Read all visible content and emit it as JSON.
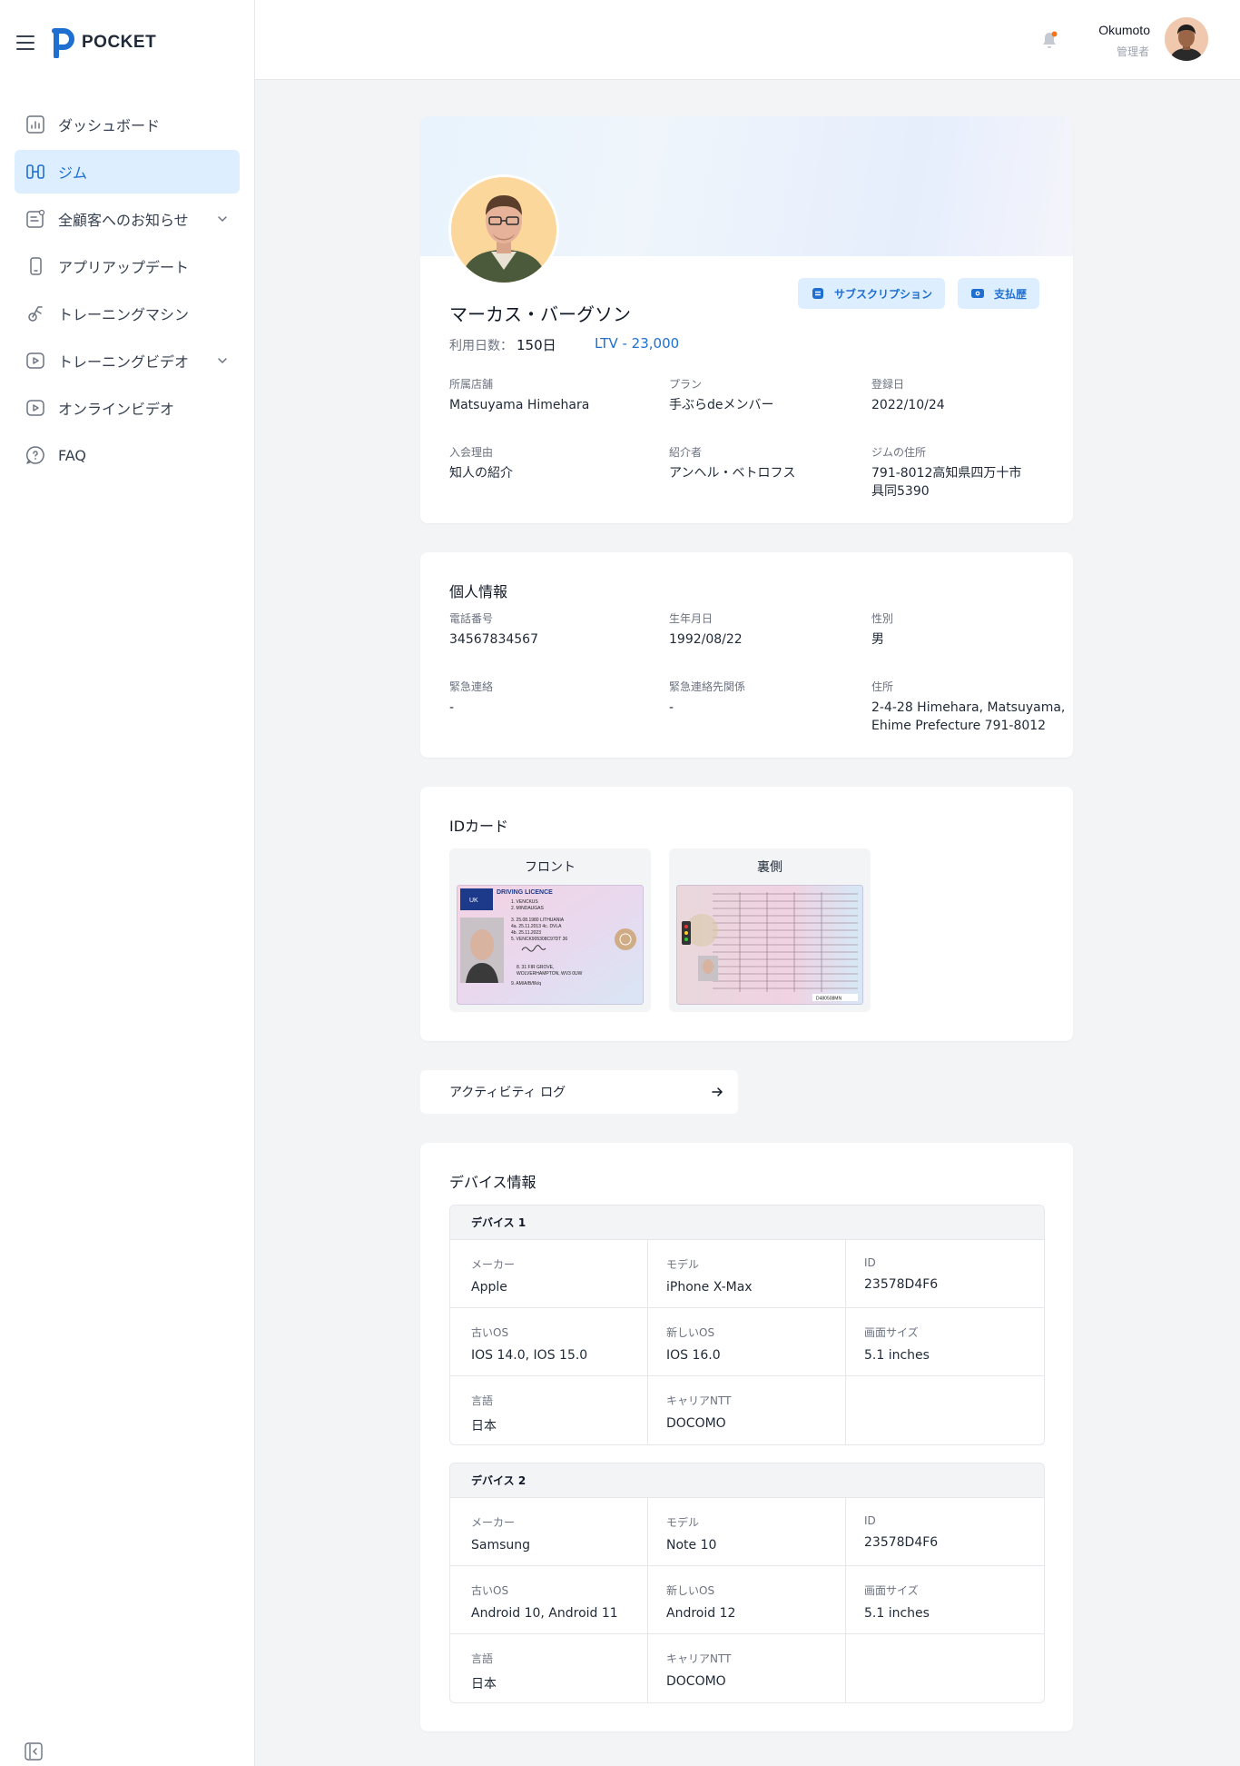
{
  "sidebar": {
    "brand": "POCKET",
    "items": [
      {
        "label": "ダッシュボード",
        "icon": "chart-icon"
      },
      {
        "label": "ジム",
        "icon": "gym-icon",
        "active": true
      },
      {
        "label": "全顧客へのお知らせ",
        "icon": "announcement-icon",
        "has_children": true
      },
      {
        "label": "アプリアップデート",
        "icon": "phone-icon"
      },
      {
        "label": "トレーニングマシン",
        "icon": "machine-icon"
      },
      {
        "label": "トレーニングビデオ",
        "icon": "video-icon",
        "has_children": true
      },
      {
        "label": "オンラインビデオ",
        "icon": "video-icon"
      },
      {
        "label": "FAQ",
        "icon": "faq-icon"
      }
    ]
  },
  "header": {
    "user_name": "Okumoto",
    "user_role": "管理者"
  },
  "profile": {
    "name": "マーカス・バーグソン",
    "days_label": "利用日数：",
    "days_value": "150日",
    "ltv": "LTV - 23,000",
    "subscription_button": "サブスクリプション",
    "payment_button": "支払歴",
    "fields": {
      "store_label": "所属店舗",
      "store_value": "Matsuyama Himehara",
      "plan_label": "プラン",
      "plan_value": "手ぶらdeメンバー",
      "registered_label": "登録日",
      "registered_value": "2022/10/24",
      "reason_label": "入会理由",
      "reason_value": "知人の紹介",
      "referrer_label": "紹介者",
      "referrer_value": "アンヘル・ベトロフス",
      "gym_address_label": "ジムの住所",
      "gym_address_line1": "791-8012高知県四万十市",
      "gym_address_line2": "具同5390"
    }
  },
  "personal": {
    "title": "個人情報",
    "phone_label": "電話番号",
    "phone_value": "34567834567",
    "birth_label": "生年月日",
    "birth_value": "1992/08/22",
    "gender_label": "性別",
    "gender_value": "男",
    "emergency_label": "緊急連絡",
    "emergency_value": "-",
    "relation_label": "緊急連絡先関係",
    "relation_value": "-",
    "address_label": "住所",
    "address_line1": "2-4-28 Himehara, Matsuyama,",
    "address_line2": "Ehime Prefecture 791-8012"
  },
  "id_card": {
    "title": "IDカード",
    "front_label": "フロント",
    "back_label": "裏側",
    "front_lines": {
      "heading": "DRIVING LICENCE",
      "country": "UK",
      "line1": "1. VENCKUS",
      "line2": "2. MINDAUGAS",
      "line3": "3. 25.08.1980 LITHUANIA",
      "line4": "4a. 25.11.2013  4c. DVLA",
      "line5": "4b. 25.11.2023",
      "line6": "5. VENCK905308C97DT 36",
      "line7": "8. 31 FIR GROVE,",
      "line8": "WOLVERHAMPTON, WV3 0UW",
      "line9": "9. AM/A/B/f/k/q"
    },
    "back_serial": "D480508MN"
  },
  "activity_log": {
    "label": "アクティビティ ログ"
  },
  "devices": {
    "title": "デバイス情報",
    "labels": {
      "maker": "メーカー",
      "model": "モデル",
      "id": "ID",
      "old_os": "古いOS",
      "new_os": "新しいOS",
      "screen": "画面サイズ",
      "language": "言語",
      "carrier": "キャリアNTT"
    },
    "list": [
      {
        "name": "デバイス 1",
        "maker": "Apple",
        "model": "iPhone X-Max",
        "id": "23578D4F6",
        "old_os": "IOS 14.0, IOS 15.0",
        "new_os": "IOS 16.0",
        "screen": "5.1 inches",
        "language": "日本",
        "carrier": "DOCOMO"
      },
      {
        "name": "デバイス 2",
        "maker": "Samsung",
        "model": "Note 10",
        "id": "23578D4F6",
        "old_os": "Android 10, Android 11",
        "new_os": "Android 12",
        "screen": "5.1 inches",
        "language": "日本",
        "carrier": "DOCOMO"
      }
    ]
  },
  "colors": {
    "accent": "#1f6fd1",
    "active_bg": "#dceeff",
    "page_bg": "#f3f4f6",
    "notification_dot": "#f97316"
  }
}
